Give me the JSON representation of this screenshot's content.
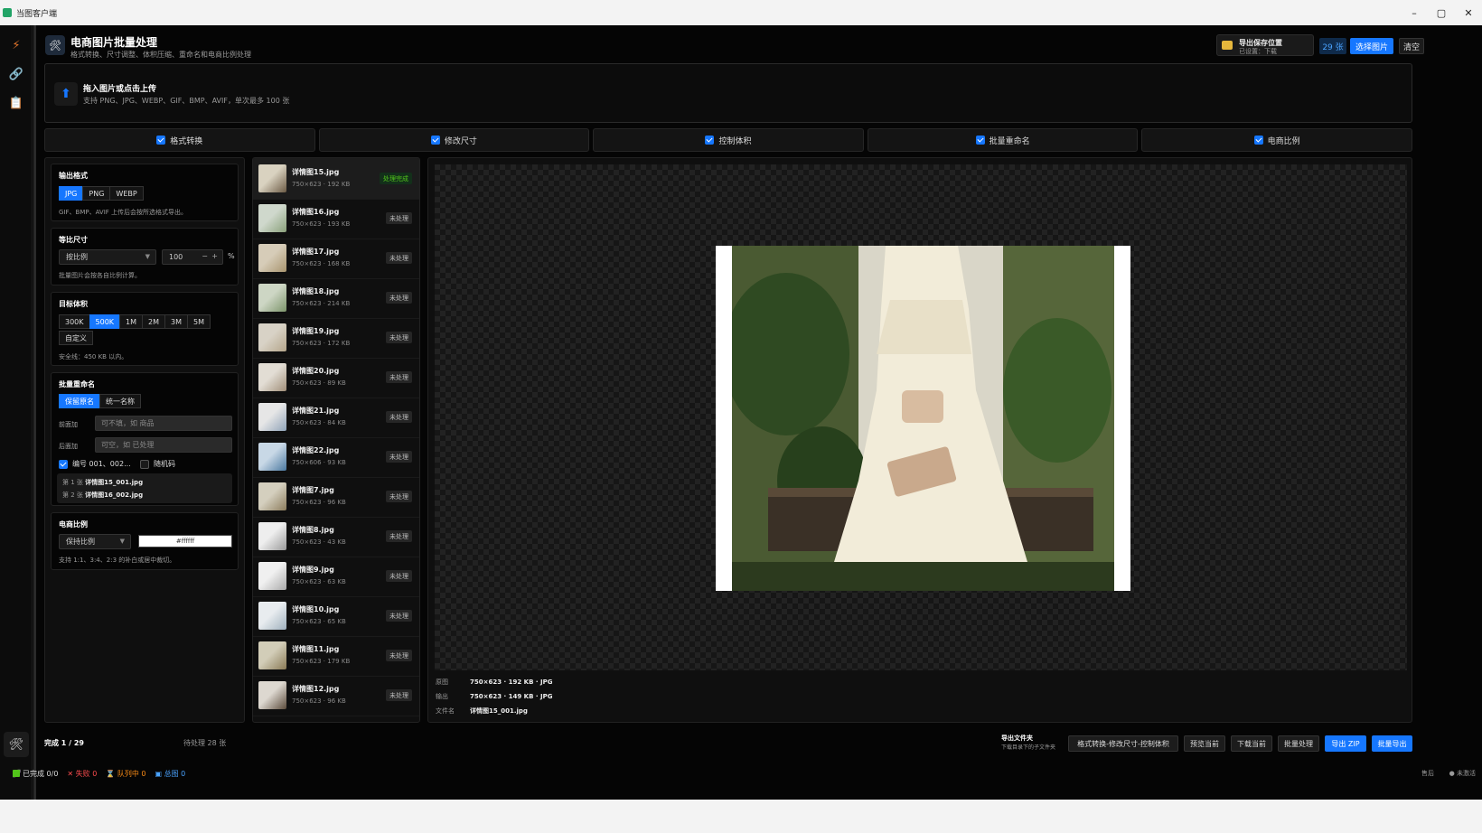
{
  "window": {
    "title": "当图客户端",
    "controls": [
      "–",
      "▢",
      "✕"
    ]
  },
  "header": {
    "title": "电商图片批量处理",
    "subtitle": "格式转换、尺寸调整、体积压缩、重命名和电商比例处理",
    "save_location_title": "导出保存位置",
    "save_location_value": "已设置：下载",
    "count": "29 张",
    "select_button": "选择图片",
    "clear_button": "清空"
  },
  "upload": {
    "title": "拖入图片或点击上传",
    "hint": "支持 PNG、JPG、WEBP、GIF、BMP、AVIF，单次最多 100 张"
  },
  "tabs": [
    {
      "label": "格式转换",
      "checked": true
    },
    {
      "label": "修改尺寸",
      "checked": true
    },
    {
      "label": "控制体积",
      "checked": true
    },
    {
      "label": "批量重命名",
      "checked": true
    },
    {
      "label": "电商比例",
      "checked": true
    }
  ],
  "format": {
    "title": "输出格式",
    "options": [
      "JPG",
      "PNG",
      "WEBP"
    ],
    "selected": "JPG",
    "hint": "GIF、BMP、AVIF 上传后会按所选格式导出。"
  },
  "resize": {
    "title": "等比尺寸",
    "mode": "按比例",
    "value": "100",
    "unit": "%",
    "hint": "批量图片会按各自比例计算。"
  },
  "size": {
    "title": "目标体积",
    "options": [
      "300K",
      "500K",
      "1M",
      "2M",
      "3M",
      "5M"
    ],
    "selected": "500K",
    "custom": "自定义",
    "hint": "安全线：450 KB 以内。"
  },
  "rename": {
    "title": "批量重命名",
    "modes": [
      "保留原名",
      "统一名称"
    ],
    "selected_mode": "保留原名",
    "prefix_label": "前面加",
    "prefix_placeholder": "可不填，如 商品",
    "suffix_label": "后面加",
    "suffix_placeholder": "可空，如 已处理",
    "numbering_label": "编号 001、002...",
    "numbering_checked": true,
    "random_label": "随机码",
    "random_checked": false,
    "examples": [
      {
        "prefix": "第 1 张",
        "name": "详情图15_001.jpg"
      },
      {
        "prefix": "第 2 张",
        "name": "详情图16_002.jpg"
      }
    ]
  },
  "ratio": {
    "title": "电商比例",
    "mode": "保持比例",
    "fill_color": "#ffffff",
    "hint": "支持 1:1、3:4、2:3 的补白或居中裁切。"
  },
  "files": [
    {
      "name": "详情图15.jpg",
      "meta": "750×623 · 192 KB",
      "status": "处理完成",
      "done": true
    },
    {
      "name": "详情图16.jpg",
      "meta": "750×623 · 193 KB",
      "status": "未处理",
      "done": false
    },
    {
      "name": "详情图17.jpg",
      "meta": "750×623 · 168 KB",
      "status": "未处理",
      "done": false
    },
    {
      "name": "详情图18.jpg",
      "meta": "750×623 · 214 KB",
      "status": "未处理",
      "done": false
    },
    {
      "name": "详情图19.jpg",
      "meta": "750×623 · 172 KB",
      "status": "未处理",
      "done": false
    },
    {
      "name": "详情图20.jpg",
      "meta": "750×623 · 89 KB",
      "status": "未处理",
      "done": false
    },
    {
      "name": "详情图21.jpg",
      "meta": "750×623 · 84 KB",
      "status": "未处理",
      "done": false
    },
    {
      "name": "详情图22.jpg",
      "meta": "750×606 · 93 KB",
      "status": "未处理",
      "done": false
    },
    {
      "name": "详情图7.jpg",
      "meta": "750×623 · 96 KB",
      "status": "未处理",
      "done": false
    },
    {
      "name": "详情图8.jpg",
      "meta": "750×623 · 43 KB",
      "status": "未处理",
      "done": false
    },
    {
      "name": "详情图9.jpg",
      "meta": "750×623 · 63 KB",
      "status": "未处理",
      "done": false
    },
    {
      "name": "详情图10.jpg",
      "meta": "750×623 · 65 KB",
      "status": "未处理",
      "done": false
    },
    {
      "name": "详情图11.jpg",
      "meta": "750×623 · 179 KB",
      "status": "未处理",
      "done": false
    },
    {
      "name": "详情图12.jpg",
      "meta": "750×623 · 96 KB",
      "status": "未处理",
      "done": false
    }
  ],
  "preview_info": [
    {
      "key": "原图",
      "value": "750×623 · 192 KB · JPG"
    },
    {
      "key": "输出",
      "value": "750×623 · 149 KB · JPG"
    },
    {
      "key": "文件名",
      "value": "详情图15_001.jpg"
    }
  ],
  "bottom": {
    "progress": "完成 1 / 29",
    "pending": "待处理 28 张",
    "export_folder_title": "导出文件夹",
    "export_folder_hint": "下载目录下的子文件夹",
    "folder_name": "格式转换-修改尺寸-控制体积",
    "preview_current": "预览当前",
    "download_current": "下载当前",
    "batch_process": "批量处理",
    "export_zip": "导出 ZIP",
    "batch_export": "批量导出"
  },
  "status": {
    "done": "已完成 0/0",
    "failed": "失败 0",
    "queue": "队列中 0",
    "total": "总图 0",
    "right1": "售后",
    "right2": "● 未激活"
  },
  "colors": {
    "accent": "#1677ff",
    "success": "#52c41a",
    "fail": "#ff4d4f",
    "queue": "#fa8c16"
  }
}
